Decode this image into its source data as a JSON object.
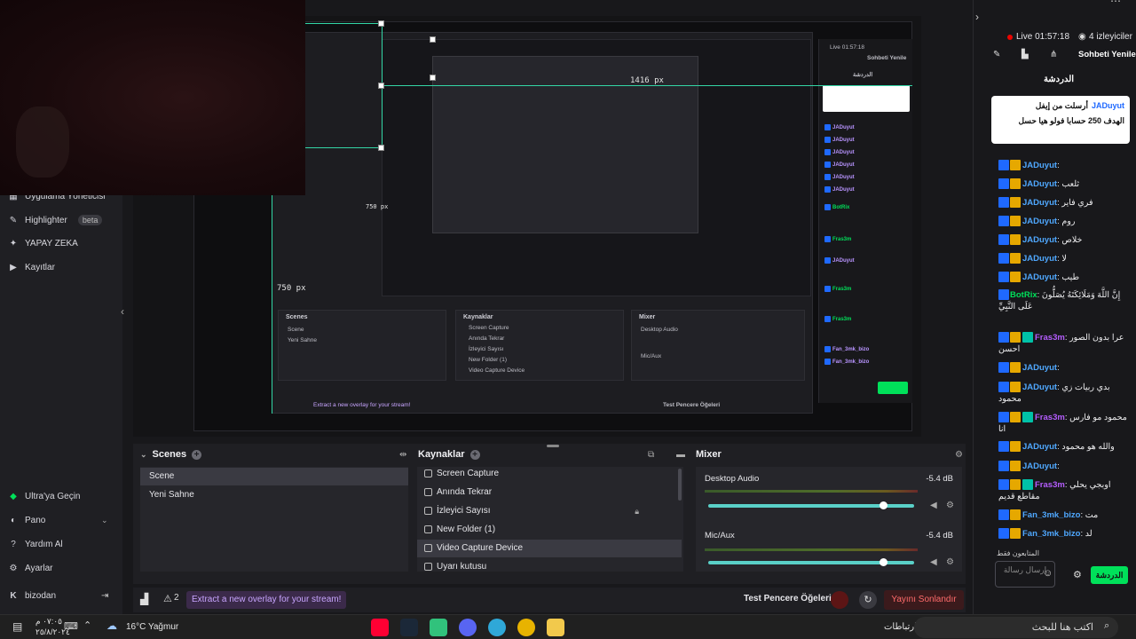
{
  "sidebar": {
    "items": [
      {
        "label": "Uygulama Yöneticisi",
        "icon": "apps-icon"
      },
      {
        "label": "Highlighter",
        "badge": "beta",
        "icon": "highlighter-icon"
      },
      {
        "label": "YAPAY ZEKA",
        "icon": "sparkle-icon"
      },
      {
        "label": "Kayıtlar",
        "icon": "play-circle-icon"
      }
    ],
    "bottom_items": [
      {
        "label": "Ultra'ya Geçin",
        "icon": "ultra-icon"
      },
      {
        "label": "Pano",
        "icon": "palette-icon"
      },
      {
        "label": "Yardım Al",
        "icon": "help-icon"
      },
      {
        "label": "Ayarlar",
        "icon": "gear-icon"
      }
    ],
    "user": {
      "name": "bizodan",
      "logout_icon": "logout-icon"
    }
  },
  "preview": {
    "width_label": "1416 px",
    "height_label": "750 px",
    "inner_width_label": "1416 px",
    "inner_height_label": "750 px"
  },
  "scenes": {
    "title": "Scenes",
    "items": [
      "Scene",
      "Yeni Sahne"
    ],
    "selected": "Scene"
  },
  "sources": {
    "title": "Kaynaklar",
    "items": [
      "Screen Capture",
      "Anında Tekrar",
      "İzleyici Sayısı",
      "New Folder (1)",
      "Video Capture Device",
      "Uyarı kutusu"
    ],
    "selected": "Video Capture Device"
  },
  "mixer": {
    "title": "Mixer",
    "channels": [
      {
        "name": "Desktop Audio",
        "db": "-5.4 dB",
        "level": 0.85
      },
      {
        "name": "Mic/Aux",
        "db": "-5.4 dB",
        "level": 0.85
      }
    ]
  },
  "status_bar": {
    "overlay_banner": "Extract a new overlay for your stream!",
    "alert_count": "2",
    "test_label": "Test Pencere Öğeleri",
    "end_stream": "Yayını Sonlandır"
  },
  "chat": {
    "live_time": "Live 01:57:18",
    "viewers": "4 izleyiciler",
    "refresh": "Sohbeti Yenile",
    "title": "الدردشة",
    "pinned_user": "JADuyut",
    "pinned_line1": "أرسلت من إيفل",
    "pinned_line2": "الهدف 250 حسابا فولو هيا حسل",
    "messages": [
      {
        "user": "JADuyut",
        "text": "",
        "color": "blue"
      },
      {
        "user": "JADuyut",
        "text": "ثلعب",
        "color": "blue"
      },
      {
        "user": "JADuyut",
        "text": "فري فاير",
        "color": "blue"
      },
      {
        "user": "JADuyut",
        "text": "روم",
        "color": "blue"
      },
      {
        "user": "JADuyut",
        "text": "خلاص",
        "color": "blue"
      },
      {
        "user": "JADuyut",
        "text": "لا",
        "color": "blue"
      },
      {
        "user": "JADuyut",
        "text": "طيب",
        "color": "blue"
      },
      {
        "user": "BotRix",
        "text": "إِنَّ اللَّهَ وَمَلَائِكَتَهُ يُصَلُّونَ عَلَى النَّبِيِّ",
        "color": "green"
      },
      {
        "user": "Fras3m",
        "text": "عرا بدون الصور احسن",
        "color": "purple"
      },
      {
        "user": "JADuyut",
        "text": "",
        "color": "blue"
      },
      {
        "user": "JADuyut",
        "text": "بدي ربيات زي محمود",
        "color": "blue"
      },
      {
        "user": "Fras3m",
        "text": "محمود مو فارس انا",
        "color": "purple"
      },
      {
        "user": "JADuyut",
        "text": "والله هو محمود",
        "color": "blue"
      },
      {
        "user": "JADuyut",
        "text": "",
        "color": "blue"
      },
      {
        "user": "Fras3m",
        "text": "اوبجي يحلي مقاطع قديم",
        "color": "purple"
      },
      {
        "user": "Fan_3mk_bizo",
        "text": "مت",
        "color": "blue"
      },
      {
        "user": "Fan_3mk_bizo",
        "text": "لد",
        "color": "blue"
      }
    ],
    "only_followers": "المتابعون فقط",
    "input_placeholder": "إرسال رسالة",
    "send_label": "الدردشة"
  },
  "taskbar": {
    "time": "٠٧:٠٥ م",
    "date": "٢٥/٨/٢٠٢٤",
    "weather": "16°C Yağmur",
    "search_placeholder": "اكتب هنا للبحث",
    "connections": "ارتباطات"
  }
}
